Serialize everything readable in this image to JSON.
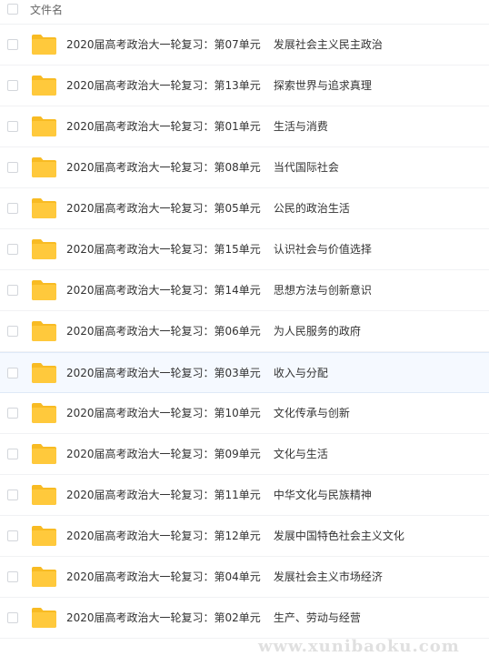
{
  "header": {
    "title": "文件名"
  },
  "colors": {
    "folder": "#ffc93c",
    "folder_back": "#f8bb23",
    "row_highlight": "#f5f9ff"
  },
  "files": [
    {
      "name": "2020届高考政治大一轮复习：第07单元",
      "sub": "发展社会主义民主政治",
      "icon": "folder-icon"
    },
    {
      "name": "2020届高考政治大一轮复习：第13单元",
      "sub": "探索世界与追求真理",
      "icon": "folder-icon"
    },
    {
      "name": "2020届高考政治大一轮复习：第01单元",
      "sub": "生活与消费",
      "icon": "folder-icon"
    },
    {
      "name": "2020届高考政治大一轮复习：第08单元",
      "sub": "当代国际社会",
      "icon": "folder-icon"
    },
    {
      "name": "2020届高考政治大一轮复习：第05单元",
      "sub": "公民的政治生活",
      "icon": "folder-icon"
    },
    {
      "name": "2020届高考政治大一轮复习：第15单元",
      "sub": "认识社会与价值选择",
      "icon": "folder-icon"
    },
    {
      "name": "2020届高考政治大一轮复习：第14单元",
      "sub": "思想方法与创新意识",
      "icon": "folder-icon"
    },
    {
      "name": "2020届高考政治大一轮复习：第06单元",
      "sub": "为人民服务的政府",
      "icon": "folder-icon"
    },
    {
      "name": "2020届高考政治大一轮复习：第03单元",
      "sub": "收入与分配",
      "icon": "folder-icon",
      "highlighted": true
    },
    {
      "name": "2020届高考政治大一轮复习：第10单元",
      "sub": "文化传承与创新",
      "icon": "folder-icon"
    },
    {
      "name": "2020届高考政治大一轮复习：第09单元",
      "sub": "文化与生活",
      "icon": "folder-icon"
    },
    {
      "name": "2020届高考政治大一轮复习：第11单元",
      "sub": "中华文化与民族精神",
      "icon": "folder-icon"
    },
    {
      "name": "2020届高考政治大一轮复习：第12单元",
      "sub": "发展中国特色社会主义文化",
      "icon": "folder-icon"
    },
    {
      "name": "2020届高考政治大一轮复习：第04单元",
      "sub": "发展社会主义市场经济",
      "icon": "folder-icon"
    },
    {
      "name": "2020届高考政治大一轮复习：第02单元",
      "sub": "生产、劳动与经营",
      "icon": "folder-icon"
    }
  ],
  "watermark": "www.xunibaoku.com"
}
